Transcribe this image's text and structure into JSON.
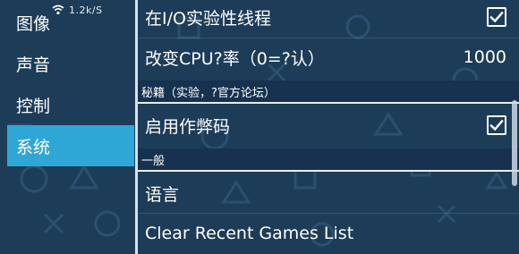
{
  "status_bar": {
    "speed": "1.2k/S",
    "wifi_icon": "wifi-icon"
  },
  "sidebar": {
    "items": [
      {
        "label": "图像",
        "selected": false
      },
      {
        "label": "声音",
        "selected": false
      },
      {
        "label": "控制",
        "selected": false
      },
      {
        "label": "系统",
        "selected": true
      }
    ]
  },
  "settings": {
    "io_thread": {
      "label": "在I/O实验性线程",
      "checked": true
    },
    "cpu_clock": {
      "label": "改变CPU?率（0=?认）",
      "value": "1000"
    },
    "cheats_header": "秘籍（实验，?官方论坛）",
    "enable_cheats": {
      "label": "启用作弊码",
      "checked": true
    },
    "general_header": "一般",
    "language": {
      "label": "语言"
    },
    "clear_recent": {
      "label": "Clear Recent Games List"
    }
  },
  "colors": {
    "background": "#1d3c57",
    "accent": "#2ea7d6",
    "header_bg": "#163250"
  }
}
